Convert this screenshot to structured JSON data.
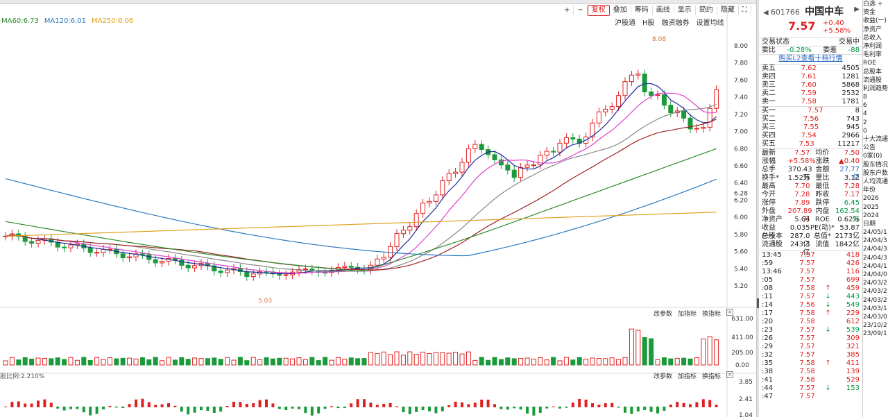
{
  "toolbar": {
    "plus": "+",
    "minus": "−",
    "fuquan": "复权",
    "add": "叠加",
    "chip": "筹码",
    "draw": "画线",
    "show": "显示",
    "simple": "简约",
    "hide": "隐藏",
    "fullscreen": "⛶"
  },
  "subtool": [
    "沪股通",
    "H股",
    "融资融券",
    "设置均线"
  ],
  "ma_legend": [
    {
      "text": "MA60:6.73",
      "color": "#2a8a2a"
    },
    {
      "text": "MA120:6.01",
      "color": "#2a7ac0"
    },
    {
      "text": "MA250:6.06",
      "color": "#e0a020"
    }
  ],
  "volume_header": [
    "改参数",
    "加指标",
    "换指标"
  ],
  "macd_header": [
    "改参数",
    "加指标",
    "换指标"
  ],
  "macd_legend": "股比例:2.210%",
  "price_axis": [
    "8.00",
    "7.80",
    "7.60",
    "7.40",
    "7.20",
    "7.00",
    "6.80",
    "6.60",
    "6.40",
    "6.28",
    "6.20",
    "6.00",
    "5.80",
    "5.60",
    "5.40",
    "5.20"
  ],
  "volume_axis": [
    "631.00",
    "411.00",
    "205.00",
    "0.00"
  ],
  "macd_axis": [
    "3.85",
    "2.41",
    "1.04"
  ],
  "annotations": {
    "high": "8.08",
    "low": "5.03"
  },
  "stock": {
    "code": "601766",
    "name": "中国中车",
    "price": "7.57",
    "change": "+0.40",
    "pct": "+5.58%"
  },
  "status": {
    "label": "交易状态",
    "value": "交易中"
  },
  "ratio": {
    "wb_label": "委比",
    "wb": "-0.28%",
    "wc_label": "委差",
    "wc": "-88"
  },
  "l2_link": "购买L2查看十档行情",
  "asks": [
    {
      "l": "卖五",
      "p": "7.62",
      "v": "4505"
    },
    {
      "l": "卖四",
      "p": "7.61",
      "v": "1281"
    },
    {
      "l": "卖三",
      "p": "7.60",
      "v": "5868"
    },
    {
      "l": "卖二",
      "p": "7.59",
      "v": "2532"
    },
    {
      "l": "卖一",
      "p": "7.58",
      "v": "1781"
    }
  ],
  "bids": [
    {
      "l": "买一",
      "p": "7.57",
      "v": "8"
    },
    {
      "l": "买二",
      "p": "7.56",
      "v": "743"
    },
    {
      "l": "买三",
      "p": "7.55",
      "v": "945"
    },
    {
      "l": "买四",
      "p": "7.54",
      "v": "2966"
    },
    {
      "l": "买五",
      "p": "7.53",
      "v": "11217"
    }
  ],
  "stats": [
    [
      "最新",
      "7.57",
      "均价",
      "7.50"
    ],
    [
      "涨幅",
      "+5.58%",
      "涨跌",
      "▲0.40"
    ],
    [
      "总手",
      "370.43万",
      "金额",
      "27.77亿"
    ],
    [
      "换手*",
      "1.52%",
      "量比",
      "3.12"
    ],
    [
      "最高",
      "7.70",
      "最低",
      "7.28"
    ],
    [
      "今开",
      "7.28",
      "昨收",
      "7.17"
    ],
    [
      "涨停",
      "7.89",
      "跌停",
      "6.45"
    ],
    [
      "外盘",
      "207.89万",
      "内盘",
      "162.54万"
    ],
    [
      "净资产",
      "5.64",
      "ROE",
      "0.62%"
    ],
    [
      "收益(一)",
      "0.035",
      "PE(动)*",
      "53.87"
    ],
    [
      "总股本",
      "287.0亿",
      "总值*",
      "2173亿"
    ],
    [
      "流通股",
      "243.3亿",
      "流值",
      "1842亿"
    ]
  ],
  "ticks": [
    {
      "t": "13:45",
      "p": "7.57",
      "v": "418",
      "d": ""
    },
    {
      "t": ":59",
      "p": "7.57",
      "v": "426",
      "d": ""
    },
    {
      "t": "13:46",
      "p": "7.57",
      "v": "116",
      "d": ""
    },
    {
      "t": ":05",
      "p": "7.57",
      "v": "699",
      "d": ""
    },
    {
      "t": ":08",
      "p": "7.58",
      "v": "459",
      "d": "up"
    },
    {
      "t": ":11",
      "p": "7.57",
      "v": "443",
      "d": "down"
    },
    {
      "t": ":14",
      "p": "7.56",
      "v": "549",
      "d": "down"
    },
    {
      "t": ":17",
      "p": "7.58",
      "v": "229",
      "d": "up"
    },
    {
      "t": ":20",
      "p": "7.58",
      "v": "612",
      "d": ""
    },
    {
      "t": ":23",
      "p": "7.57",
      "v": "539",
      "d": "down"
    },
    {
      "t": ":26",
      "p": "7.57",
      "v": "309",
      "d": ""
    },
    {
      "t": ":29",
      "p": "7.57",
      "v": "321",
      "d": ""
    },
    {
      "t": ":32",
      "p": "7.57",
      "v": "385",
      "d": ""
    },
    {
      "t": ":35",
      "p": "7.58",
      "v": "411",
      "d": "up"
    },
    {
      "t": ":38",
      "p": "7.58",
      "v": "139",
      "d": ""
    },
    {
      "t": ":41",
      "p": "7.58",
      "v": "529",
      "d": ""
    },
    {
      "t": ":44",
      "p": "7.57",
      "v": "153",
      "d": "down"
    },
    {
      "t": ":47",
      "p": "7.57",
      "v": "",
      "d": ""
    }
  ],
  "far": [
    "白选 +",
    "资金",
    "收益(一)",
    "净资产",
    "总收入",
    "净利润",
    "毛利率",
    "ROE",
    "总股本",
    "流通股",
    "利润趋势",
    "8",
    "6",
    "4",
    "2",
    "0",
    "十大流通",
    "公告",
    "0家(0)",
    "股东情况",
    "股东户数",
    "人均流通",
    "年份",
    "2026",
    "2025",
    "2024",
    "日期",
    "24/05/1",
    "24/04/3",
    "24/04/3",
    "24/04/3",
    "24/04/1",
    "24/04/0",
    "24/03/2",
    "24/03/2",
    "24/03/2",
    "24/03/1",
    "24/03/0",
    "23/10/2",
    "23/09/1"
  ]
}
